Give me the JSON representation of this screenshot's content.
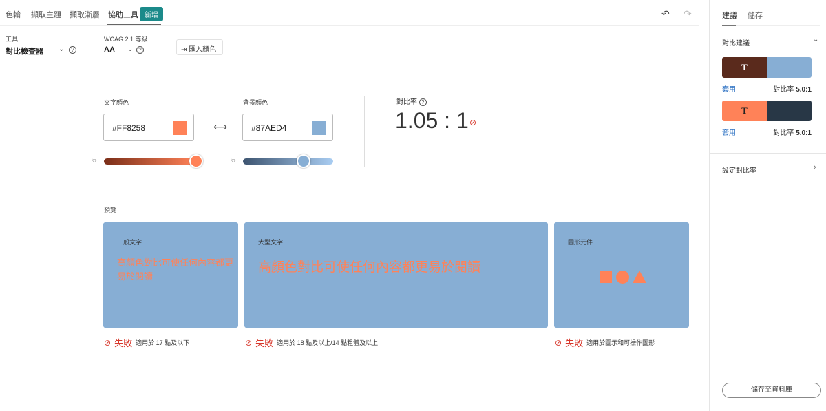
{
  "tabs": [
    "色輪",
    "擷取主題",
    "擷取漸層",
    "協助工具"
  ],
  "new_badge": "新增",
  "tool": {
    "label": "工具",
    "value": "對比檢查器"
  },
  "wcag": {
    "label": "WCAG 2.1 等級",
    "value": "AA"
  },
  "import_label": "匯入顏色",
  "text_color": {
    "label": "文字顏色",
    "value": "#FF8258",
    "hex": "#ff8258"
  },
  "bg_color": {
    "label": "背景顏色",
    "value": "#87AED4",
    "hex": "#87aed4"
  },
  "contrast": {
    "label": "對比率",
    "value": "1.05 : 1"
  },
  "preview": {
    "label": "預覽",
    "cards": [
      {
        "title": "一般文字",
        "text": "高顏色對比可使任何內容都更易於閱讀",
        "status": "失敗",
        "note": "適用於 17 點及以下"
      },
      {
        "title": "大型文字",
        "text": "高顏色對比可使任何內容都更易於閱讀",
        "status": "失敗",
        "note": "適用於 18 點及以上/14 點粗體及以上"
      },
      {
        "title": "圖形元件",
        "status": "失敗",
        "note": "適用於圖示和可操作圖形"
      }
    ]
  },
  "sidebar": {
    "tabs": [
      "建議",
      "儲存"
    ],
    "section": "對比建議",
    "suggestions": [
      {
        "glyph": "T",
        "fg": "#5a2a1c",
        "bg": "#87aed4",
        "apply": "套用",
        "ratio_label": "對比率",
        "ratio": "5.0:1"
      },
      {
        "glyph": "T",
        "fg": "#ff8258",
        "bg": "#283746",
        "apply": "套用",
        "ratio_label": "對比率",
        "ratio": "5.0:1"
      }
    ],
    "set_ratio": "設定對比率",
    "save": "儲存至資料庫"
  }
}
